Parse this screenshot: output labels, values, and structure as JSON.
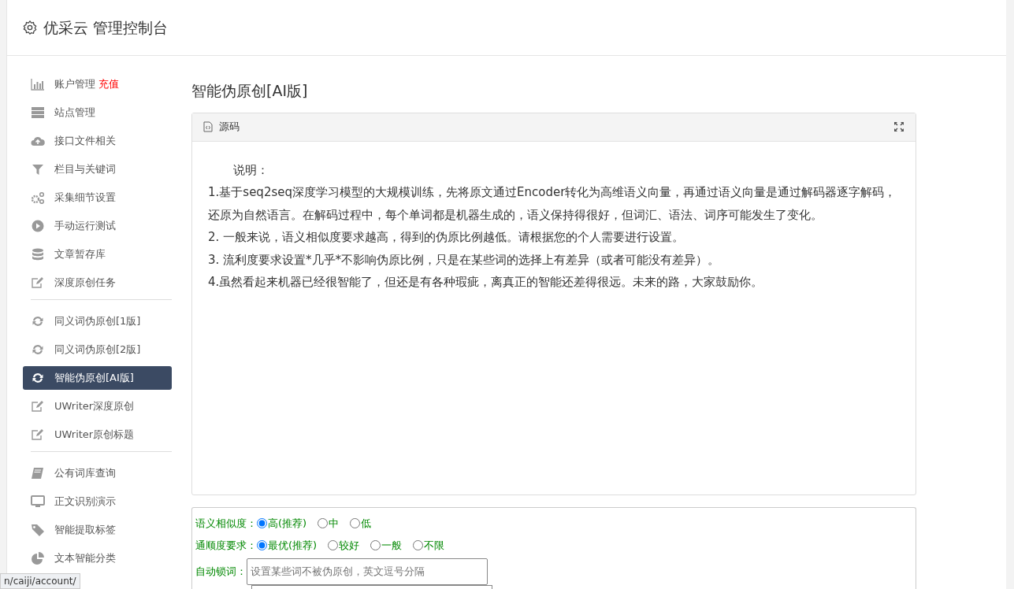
{
  "header": {
    "title": "优采云 管理控制台"
  },
  "sidebar": {
    "groups": [
      {
        "items": [
          {
            "label": "账户管理",
            "badge": "充值",
            "kind": "chart",
            "selected": false
          },
          {
            "label": "站点管理",
            "kind": "server",
            "selected": false
          },
          {
            "label": "接口文件相关",
            "kind": "cloud",
            "selected": false
          },
          {
            "label": "栏目与关键词",
            "kind": "filter",
            "selected": false
          },
          {
            "label": "采集细节设置",
            "kind": "gears",
            "selected": false
          },
          {
            "label": "手动运行测试",
            "kind": "play",
            "selected": false
          },
          {
            "label": "文章暂存库",
            "kind": "database",
            "selected": false
          },
          {
            "label": "深度原创任务",
            "kind": "edit",
            "selected": false
          }
        ]
      },
      {
        "items": [
          {
            "label": "同义词伪原创[1版]",
            "kind": "refresh",
            "selected": false
          },
          {
            "label": "同义词伪原创[2版]",
            "kind": "refresh",
            "selected": false
          },
          {
            "label": "智能伪原创[AI版]",
            "kind": "refresh",
            "selected": true
          },
          {
            "label": "UWriter深度原创",
            "kind": "edit",
            "selected": false
          },
          {
            "label": "UWriter原创标题",
            "kind": "edit",
            "selected": false
          }
        ]
      },
      {
        "items": [
          {
            "label": "公有词库查询",
            "kind": "book",
            "selected": false
          },
          {
            "label": "正文识别演示",
            "kind": "monitor",
            "selected": false
          },
          {
            "label": "智能提取标签",
            "kind": "tag",
            "selected": false
          },
          {
            "label": "文本智能分类",
            "kind": "pie",
            "selected": false
          }
        ]
      }
    ]
  },
  "main": {
    "title": "智能伪原创[AI版]",
    "editor": {
      "tab": "源码",
      "lines": [
        {
          "kind": "heading",
          "text": "说明："
        },
        {
          "kind": "para",
          "text": "1.基于seq2seq深度学习模型的大规模训练，先将原文通过Encoder转化为高维语义向量，再通过语义向量是通过解码器逐字解码，还原为自然语言。在解码过程中，每个单词都是机器生成的，语义保持得很好，但词汇、语法、词序可能发生了变化。"
        },
        {
          "kind": "para",
          "text": "2. 一般来说，语义相似度要求越高，得到的伪原比例越低。请根据您的个人需要进行设置。"
        },
        {
          "kind": "para",
          "text": "3. 流利度要求设置*几乎*不影响伪原比例，只是在某些词的选择上有差异（或者可能没有差异）。"
        },
        {
          "kind": "para",
          "text": "4.虽然看起来机器已经很智能了，但还是有各种瑕疵，离真正的智能还差得很远。未来的路，大家鼓励你。"
        }
      ]
    },
    "form": [
      {
        "kind": "radio",
        "label": "语义相似度：",
        "options": [
          {
            "label": "高(推荐)",
            "selected": true
          },
          {
            "label": "中",
            "selected": false
          },
          {
            "label": "低",
            "selected": false
          }
        ]
      },
      {
        "kind": "radio",
        "label": "通顺度要求：",
        "options": [
          {
            "label": "最优(推荐)",
            "selected": true
          },
          {
            "label": "较好",
            "selected": false
          },
          {
            "label": "一般",
            "selected": false
          },
          {
            "label": "不限",
            "selected": false
          }
        ]
      },
      {
        "kind": "input",
        "label": "自动锁词：",
        "placeholder": "设置某些词不被伪原创，英文逗号分隔"
      },
      {
        "kind": "textarea"
      }
    ]
  },
  "status_bar": {
    "url": "n/caiji/account/"
  }
}
